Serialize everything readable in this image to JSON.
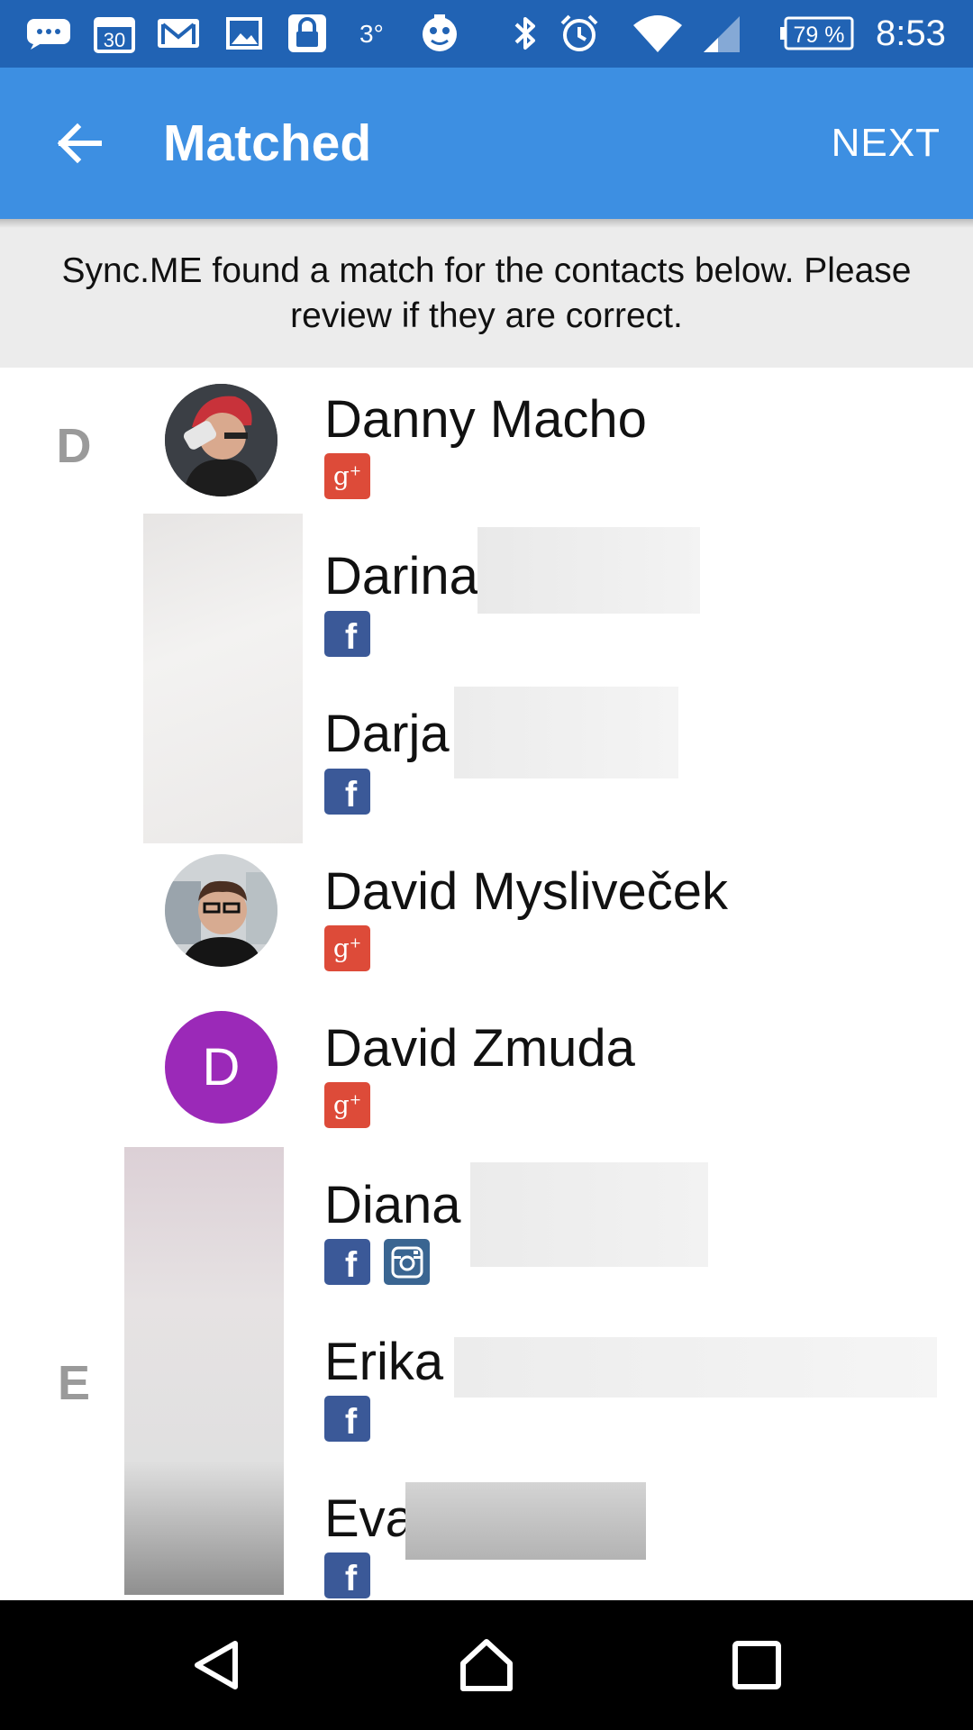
{
  "status_bar": {
    "calendar_day": "30",
    "temperature": "3°",
    "battery": "79 %",
    "time": "8:53",
    "icons": [
      "messages-icon",
      "calendar-icon",
      "gmail-icon",
      "gallery-icon",
      "lock-icon",
      "weather-icon",
      "mascot-icon",
      "bluetooth-icon",
      "alarm-icon",
      "wifi-icon",
      "signal-icon",
      "battery-icon"
    ]
  },
  "app_bar": {
    "title": "Matched",
    "action": "NEXT",
    "back_icon": "arrow-left-icon",
    "color": "#3d8fe2"
  },
  "banner": {
    "text": "Sync.ME found a match for the contacts below. Please review if they are correct."
  },
  "sections": [
    {
      "letter": "D"
    },
    {
      "letter": "E"
    }
  ],
  "contacts": [
    {
      "name": "Danny Macho",
      "networks": [
        "google-plus"
      ],
      "avatar": "photo"
    },
    {
      "name": "Darina",
      "networks": [
        "facebook"
      ],
      "avatar": "blurred"
    },
    {
      "name": "Darja",
      "networks": [
        "facebook"
      ],
      "avatar": "blurred"
    },
    {
      "name": "David Mysliveček",
      "networks": [
        "google-plus"
      ],
      "avatar": "photo"
    },
    {
      "name": "David Zmuda",
      "networks": [
        "google-plus"
      ],
      "avatar": "letter",
      "avatar_letter": "D",
      "avatar_color": "#9b29b8"
    },
    {
      "name": "Diana",
      "networks": [
        "facebook",
        "instagram"
      ],
      "avatar": "blurred"
    },
    {
      "name": "Erika",
      "networks": [
        "facebook"
      ],
      "avatar": "blurred"
    },
    {
      "name": "Eva",
      "networks": [
        "facebook"
      ],
      "avatar": "blurred"
    }
  ],
  "network_colors": {
    "google-plus": "#dd4b39",
    "facebook": "#3b5998",
    "instagram": "#3a6591"
  },
  "nav_bar": {
    "icons": [
      "back-triangle-icon",
      "home-icon",
      "recents-icon"
    ]
  }
}
